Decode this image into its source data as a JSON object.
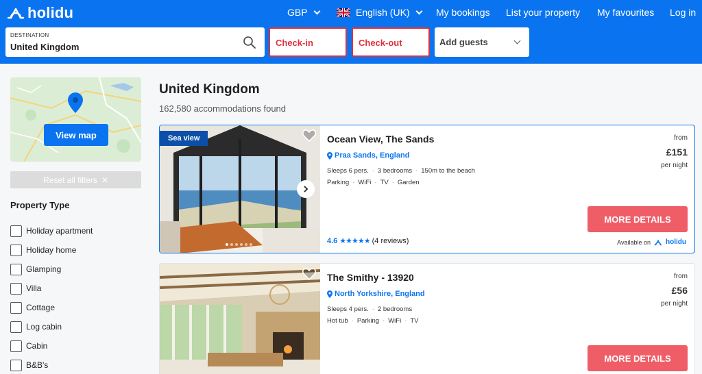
{
  "header": {
    "logo_text": "holidu",
    "currency": "GBP",
    "language": "English (UK)",
    "nav": [
      "My bookings",
      "List your property",
      "My favourites",
      "Log in"
    ]
  },
  "search": {
    "destination_label": "DESTINATION",
    "destination_value": "United Kingdom",
    "checkin": "Check-in",
    "checkout": "Check-out",
    "guests": "Add guests"
  },
  "sidebar": {
    "map_button": "View map",
    "reset_filters": "Reset all filters",
    "property_type_title": "Property Type",
    "property_types": [
      "Holiday apartment",
      "Holiday home",
      "Glamping",
      "Villa",
      "Cottage",
      "Log cabin",
      "Cabin",
      "B&B's"
    ]
  },
  "results": {
    "title": "United Kingdom",
    "count": "162,580 accommodations found"
  },
  "listings": [
    {
      "badge": "Sea view",
      "title": "Ocean View, The Sands",
      "location": "Praa Sands, England",
      "specs": [
        "Sleeps 6 pers.",
        "3 bedrooms",
        "150m to the beach"
      ],
      "features": [
        "Parking",
        "WiFi",
        "TV",
        "Garden"
      ],
      "rating_score": "4.6",
      "rating_stars": 4.6,
      "reviews": "(4 reviews)",
      "price_from": "from",
      "price": "£151",
      "per_night": "per night",
      "cta": "MORE DETAILS",
      "available_on": "Available on",
      "available_brand": "holidu"
    },
    {
      "title": "The Smithy - 13920",
      "location": "North Yorkshire, England",
      "specs": [
        "Sleeps 4 pers.",
        "2 bedrooms"
      ],
      "features": [
        "Hot tub",
        "Parking",
        "WiFi",
        "TV"
      ],
      "price_from": "from",
      "price": "£56",
      "per_night": "per night",
      "cta": "MORE DETAILS"
    }
  ],
  "colors": {
    "brand_blue": "#0a74f0",
    "cta_red": "#ef5d67",
    "error_red": "#e0313c"
  }
}
